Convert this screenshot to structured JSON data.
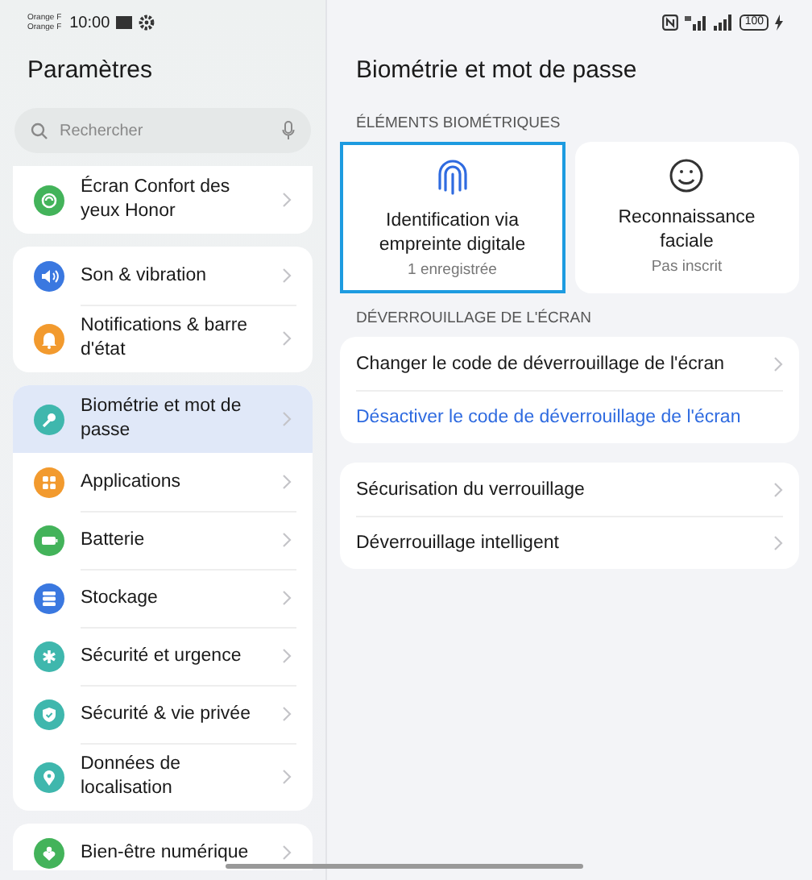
{
  "status_bar": {
    "carriers": [
      "Orange F",
      "Orange F"
    ],
    "time": "10:00",
    "battery": "100"
  },
  "sidebar": {
    "title": "Paramètres",
    "search": {
      "placeholder": "Rechercher"
    },
    "groups": [
      {
        "cut_top": true,
        "items": [
          {
            "label": "Écran Confort des yeux Honor",
            "kind": "eye",
            "color": "#43b35a",
            "selected": false
          }
        ]
      },
      {
        "items": [
          {
            "label": "Son & vibration",
            "kind": "sound",
            "color": "#3a78e0",
            "selected": false
          },
          {
            "label": "Notifications & barre d'état",
            "kind": "bell",
            "color": "#f29a2e",
            "selected": false
          }
        ]
      },
      {
        "items": [
          {
            "label": "Biométrie et mot de passe",
            "kind": "key",
            "color": "#3fb7ad",
            "selected": true
          },
          {
            "label": "Applications",
            "kind": "apps",
            "color": "#f29a2e",
            "selected": false
          },
          {
            "label": "Batterie",
            "kind": "battery",
            "color": "#43b35a",
            "selected": false
          },
          {
            "label": "Stockage",
            "kind": "storage",
            "color": "#3a78e0",
            "selected": false
          },
          {
            "label": "Sécurité et urgence",
            "kind": "asterisk",
            "color": "#3fb7ad",
            "selected": false
          },
          {
            "label": "Sécurité & vie privée",
            "kind": "shield",
            "color": "#3fb7ad",
            "selected": false
          },
          {
            "label": "Données de localisation",
            "kind": "pin",
            "color": "#3fb7ad",
            "selected": false
          }
        ]
      },
      {
        "cut_bottom": true,
        "items": [
          {
            "label": "Bien-être numérique",
            "kind": "heart",
            "color": "#43b35a",
            "selected": false
          }
        ]
      }
    ]
  },
  "page": {
    "title": "Biométrie et mot de passe",
    "biometrics_header": "ÉLÉMENTS BIOMÉTRIQUES",
    "biometrics": [
      {
        "kind": "fingerprint",
        "title": "Identification via empreinte digitale",
        "status": "1 enregistrée",
        "selected": true
      },
      {
        "kind": "face",
        "title": "Reconnaissance faciale",
        "status": "Pas inscrit",
        "selected": false
      }
    ],
    "unlock_header": "DÉVERROUILLAGE DE L'ÉCRAN",
    "cards": [
      [
        {
          "label": "Changer le code de déverrouillage de l'écran",
          "kind": "nav"
        },
        {
          "label": "Désactiver le code de déverrouillage de l'écran",
          "kind": "link"
        }
      ],
      [
        {
          "label": "Sécurisation du verrouillage",
          "kind": "nav"
        },
        {
          "label": "Déverrouillage intelligent",
          "kind": "nav"
        }
      ]
    ]
  }
}
